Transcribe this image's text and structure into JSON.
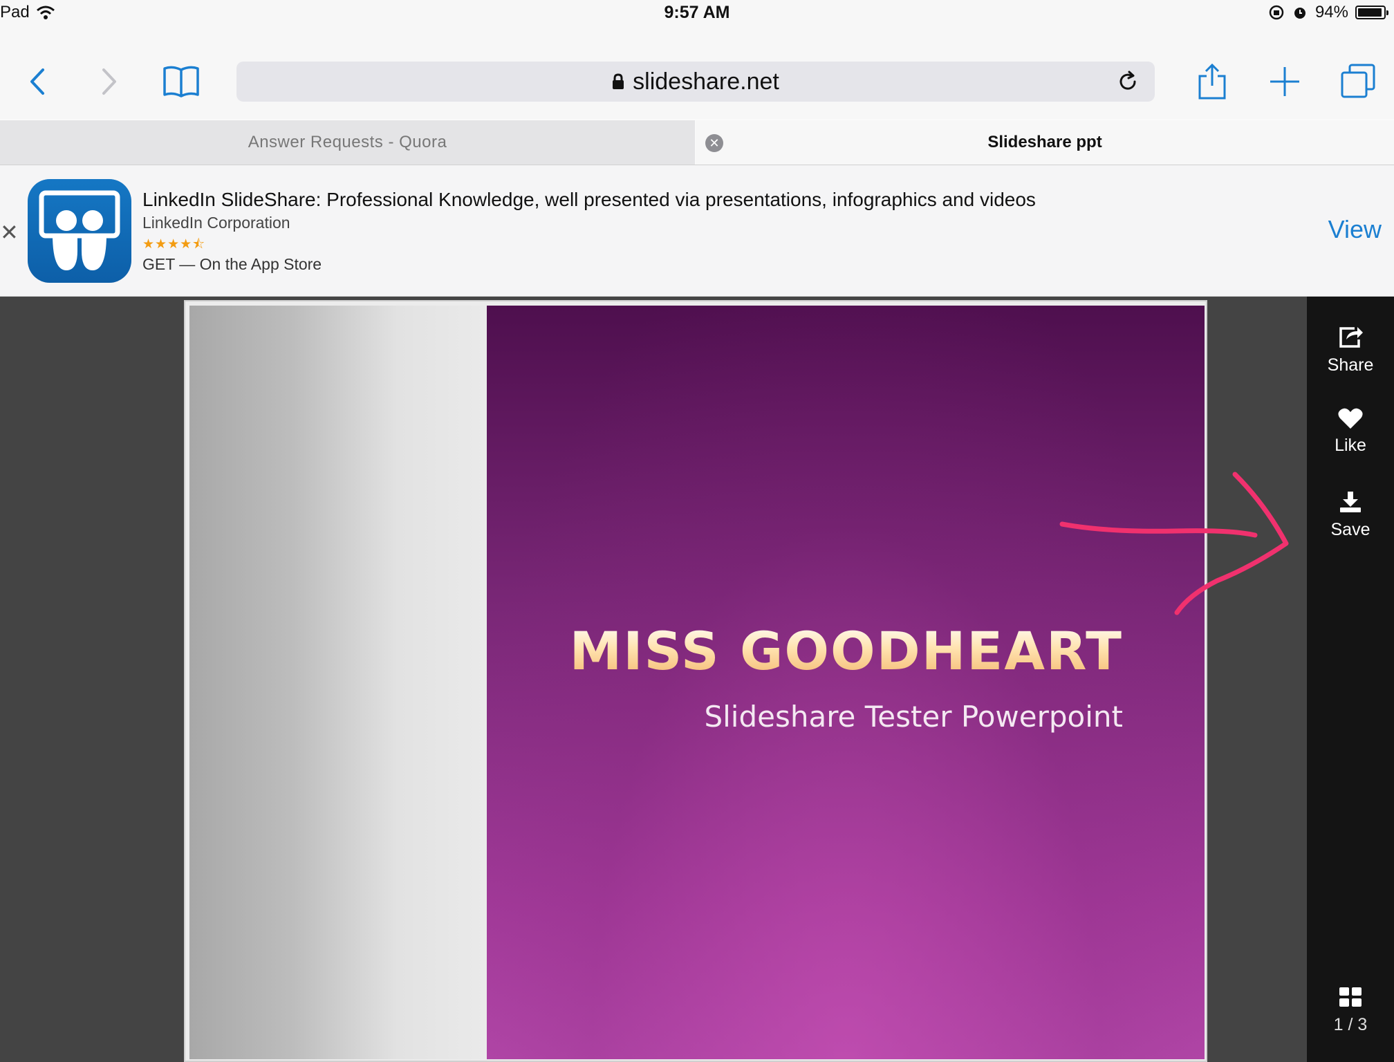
{
  "status_bar": {
    "device": "Pad",
    "time": "9:57 AM",
    "battery": "94%",
    "battery_level_percent": 94,
    "icons": [
      "wifi-icon",
      "orientation-lock-icon",
      "alarm-icon",
      "battery-icon"
    ]
  },
  "toolbar": {
    "url": "slideshare.net",
    "icons": [
      "back-icon",
      "forward-icon",
      "bookmarks-icon",
      "lock-icon",
      "reload-icon",
      "share-icon",
      "new-tab-icon",
      "tabs-icon"
    ]
  },
  "tabs": [
    {
      "label": "Answer Requests - Quora",
      "active": false
    },
    {
      "label": "Slideshare ppt",
      "active": true
    }
  ],
  "app_banner": {
    "title": "LinkedIn SlideShare: Professional Knowledge, well presented via presentations, infographics and videos",
    "publisher": "LinkedIn Corporation",
    "rating_stars": "★★★★⯪",
    "rating_value": 4.5,
    "get_text": "GET — On the App Store",
    "view_label": "View",
    "close_glyph": "✕"
  },
  "slide": {
    "title": "MISS GOODHEART",
    "subtitle": "Slideshare Tester Powerpoint"
  },
  "side_panel": {
    "share_label": "Share",
    "like_label": "Like",
    "save_label": "Save",
    "page_indicator": "1 / 3"
  },
  "colors": {
    "accent": "#1b7fd1",
    "annotation": "#f0316e",
    "slide_purple": "#7a2777"
  }
}
